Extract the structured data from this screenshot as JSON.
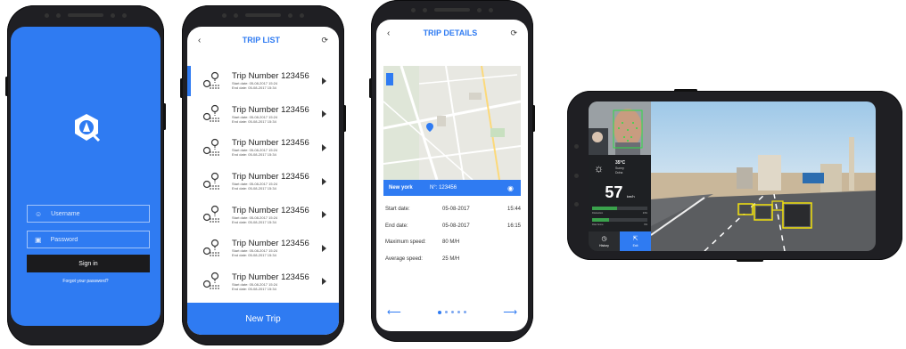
{
  "colors": {
    "brand_blue": "#2f7bf2",
    "dark": "#1b1b1d",
    "detect_yellow": "#f2e20c",
    "face_green": "#2fdc46"
  },
  "login": {
    "username_placeholder": "Username",
    "password_placeholder": "Password",
    "signin_label": "Sign in",
    "forgot_label": "Forgot your password?"
  },
  "trip_list": {
    "title": "TRIP LIST",
    "trips": [
      {
        "name": "Trip Number 123456",
        "start": "Start date: 05-08-2017  15:24",
        "end": "End date: 05-08-2017  15:34"
      },
      {
        "name": "Trip Number 123456",
        "start": "Start date: 05-08-2017  15:24",
        "end": "End date: 05-08-2017  15:34"
      },
      {
        "name": "Trip Number 123456",
        "start": "Start date: 05-08-2017  15:24",
        "end": "End date: 05-08-2017  15:34"
      },
      {
        "name": "Trip Number 123456",
        "start": "Start date: 05-08-2017  15:24",
        "end": "End date: 05-08-2017  15:34"
      },
      {
        "name": "Trip Number 123456",
        "start": "Start date: 05-08-2017  15:24",
        "end": "End date: 05-08-2017  15:34"
      },
      {
        "name": "Trip Number 123456",
        "start": "Start date: 05-08-2017  15:24",
        "end": "End date: 05-08-2017  15:34"
      },
      {
        "name": "Trip Number 123456",
        "start": "Start date: 05-08-2017  15:24",
        "end": "End date: 05-08-2017  15:34"
      }
    ],
    "new_trip_label": "New Trip"
  },
  "trip_details": {
    "title": "TRIP DETAILS",
    "location": "New york",
    "trip_no": "N°: 123456",
    "start_label": "Start date:",
    "start_date": "05-08-2017",
    "start_time": "15:44",
    "end_label": "End date:",
    "end_date": "05-08-2017",
    "end_time": "16:15",
    "max_label": "Maximum speed:",
    "max_value": "80 M/H",
    "avg_label": "Average speed:",
    "avg_value": "25 M/H"
  },
  "driving": {
    "temperature": "35°C",
    "weather_line1": "Sunny",
    "weather_line2": "Doha",
    "speed": "57",
    "speed_unit": "km/h",
    "meter1_label": "Distraction",
    "meter1_value": "23%",
    "meter1_fraction": 0.45,
    "meter2_label": "Risk Score",
    "meter2_value": "9%",
    "meter2_fraction": 0.3,
    "history_label": "History",
    "exit_label": "Exit"
  }
}
